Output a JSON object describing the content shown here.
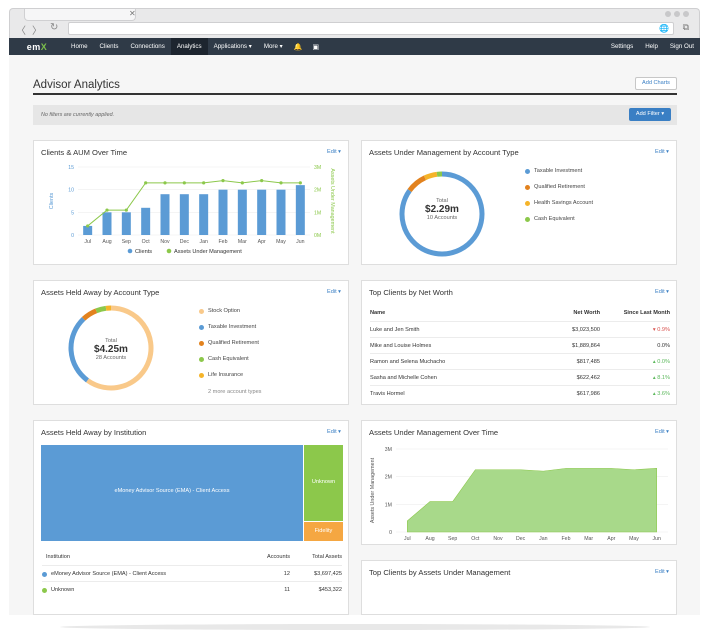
{
  "browser": {
    "tab_close": "✕",
    "back": "〈",
    "forward": "〉",
    "reload": "↻",
    "globe": "🌐",
    "ext": "⧉"
  },
  "nav": {
    "logo_prefix": "em",
    "logo_suffix": "X",
    "links": [
      "Home",
      "Clients",
      "Connections",
      "Analytics",
      "Applications ▾",
      "More ▾"
    ],
    "active": "Analytics",
    "right": [
      "Settings",
      "Help",
      "Sign Out"
    ],
    "bell": "🔔",
    "box": "▣"
  },
  "page": {
    "title": "Advisor Analytics",
    "add_charts": "Add Charts",
    "filter_text": "No filters are currently applied.",
    "add_filter": "Add Filter ▾"
  },
  "edit_label": "Edit ▾",
  "cards": {
    "clients_aum": {
      "title": "Clients & AUM Over Time",
      "legend": [
        "Clients",
        "Assets Under Management"
      ],
      "y_left_label": "Clients",
      "y_right_label": "Assets Under Management",
      "y_left_ticks": [
        "0",
        "5",
        "10",
        "15"
      ],
      "y_right_ticks": [
        "0M",
        "1M",
        "2M",
        "3M"
      ]
    },
    "aum_type": {
      "title": "Assets Under Management by Account Type",
      "center_label": "Total",
      "center_value": "$2.29m",
      "center_sub": "10 Accounts",
      "legend": [
        {
          "label": "Taxable Investment",
          "color": "#5b9bd5"
        },
        {
          "label": "Qualified Retirement",
          "color": "#e2821e"
        },
        {
          "label": "Health Savings Account",
          "color": "#f5b429"
        },
        {
          "label": "Cash Equivalent",
          "color": "#8cc84b"
        }
      ]
    },
    "held_away_type": {
      "title": "Assets Held Away by Account Type",
      "center_label": "Total",
      "center_value": "$4.25m",
      "center_sub": "28 Accounts",
      "legend": [
        {
          "label": "Stock Option",
          "color": "#f9c98a"
        },
        {
          "label": "Taxable Investment",
          "color": "#5b9bd5"
        },
        {
          "label": "Qualified Retirement",
          "color": "#e2821e"
        },
        {
          "label": "Cash Equivalent",
          "color": "#8cc84b"
        },
        {
          "label": "Life Insurance",
          "color": "#f5b429"
        }
      ],
      "more": "2 more account types"
    },
    "top_net_worth": {
      "title": "Top Clients by Net Worth",
      "headers": [
        "Name",
        "Net Worth",
        "Since Last Month"
      ],
      "rows": [
        {
          "name": "Luke and Jen Smith",
          "worth": "$3,023,500",
          "change": "▾ 0.9%",
          "dir": "neg"
        },
        {
          "name": "Mike and Louise Holmes",
          "worth": "$1,889,864",
          "change": "0.0%",
          "dir": "flat"
        },
        {
          "name": "Ramon and Selena Muchacho",
          "worth": "$817,485",
          "change": "▴ 0.0%",
          "dir": "pos"
        },
        {
          "name": "Sasha and Michelle Cohen",
          "worth": "$622,462",
          "change": "▴ 8.1%",
          "dir": "pos"
        },
        {
          "name": "Travis Hormel",
          "worth": "$617,986",
          "change": "▴ 3.6%",
          "dir": "pos"
        }
      ]
    },
    "held_away_inst": {
      "title": "Assets Held Away by Institution",
      "blocks": [
        "eMoney Advisor Source (EMA) - Client Access",
        "Unknown",
        "Fidelity"
      ],
      "headers": [
        "Institution",
        "Accounts",
        "Total Assets"
      ],
      "rows": [
        {
          "name": "eMoney Advisor Source (EMA) - Client Access",
          "accounts": "12",
          "total": "$3,697,425",
          "color": "#5b9bd5"
        },
        {
          "name": "Unknown",
          "accounts": "11",
          "total": "$453,322",
          "color": "#8cc84b"
        }
      ]
    },
    "aum_time": {
      "title": "Assets Under Management Over Time",
      "y_label": "Assets Under Management",
      "y_ticks": [
        "0",
        "1M",
        "2M",
        "3M"
      ]
    },
    "top_aum": {
      "title": "Top Clients by Assets Under Management"
    }
  },
  "chart_data": [
    {
      "type": "bar",
      "title": "Clients & AUM Over Time",
      "categories": [
        "Jul",
        "Aug",
        "Sep",
        "Oct",
        "Nov",
        "Dec",
        "Jan",
        "Feb",
        "Mar",
        "Apr",
        "May",
        "Jun"
      ],
      "series": [
        {
          "name": "Clients",
          "type": "bar",
          "values": [
            2,
            5,
            5,
            6,
            9,
            9,
            9,
            10,
            10,
            10,
            10,
            11
          ],
          "color": "#5b9bd5"
        },
        {
          "name": "Assets Under Management",
          "type": "line",
          "values": [
            0.4,
            1.1,
            1.1,
            2.3,
            2.3,
            2.3,
            2.3,
            2.4,
            2.3,
            2.4,
            2.3,
            2.3
          ],
          "color": "#8cc84b"
        }
      ],
      "ylabel": "Clients",
      "y2label": "Assets Under Management",
      "ylim": [
        0,
        15
      ],
      "y2lim": [
        0,
        3
      ],
      "legend": "bottom"
    },
    {
      "type": "pie",
      "title": "Assets Under Management by Account Type",
      "categories": [
        "Taxable Investment",
        "Qualified Retirement",
        "Health Savings Account",
        "Cash Equivalent"
      ],
      "values": [
        85,
        8,
        5,
        2
      ]
    },
    {
      "type": "pie",
      "title": "Assets Held Away by Account Type",
      "categories": [
        "Stock Option",
        "Taxable Investment",
        "Qualified Retirement",
        "Cash Equivalent",
        "Life Insurance"
      ],
      "values": [
        60,
        28,
        6,
        4,
        2
      ]
    },
    {
      "type": "area",
      "title": "Assets Under Management Over Time",
      "categories": [
        "Jul",
        "Aug",
        "Sep",
        "Oct",
        "Nov",
        "Dec",
        "Jan",
        "Feb",
        "Mar",
        "Apr",
        "May",
        "Jun"
      ],
      "values": [
        0.4,
        1.1,
        1.1,
        2.25,
        2.25,
        2.25,
        2.2,
        2.3,
        2.3,
        2.3,
        2.25,
        2.3
      ],
      "ylabel": "Assets Under Management",
      "ylim": [
        0,
        3
      ]
    }
  ]
}
